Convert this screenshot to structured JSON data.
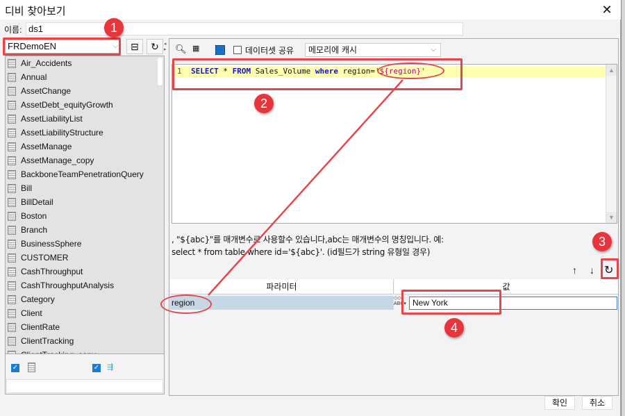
{
  "window": {
    "title": "디비 찾아보기",
    "close_icon": "close-icon"
  },
  "name_field": {
    "label": "이름:",
    "value": "ds1"
  },
  "database_select": {
    "value": "FRDemoEN"
  },
  "table_list": {
    "items": [
      "Air_Accidents",
      "Annual",
      "AssetChange",
      "AssetDebt_equityGrowth",
      "AssetLiabilityList",
      "AssetLiabilityStructure",
      "AssetManage",
      "AssetManage_copy",
      "BackboneTeamPenetrationQuery",
      "Bill",
      "BillDetail",
      "Boston",
      "Branch",
      "BusinessSphere",
      "CUSTOMER",
      "CashThroughput",
      "CashThroughputAnalysis",
      "Category",
      "Client",
      "ClientRate",
      "ClientTracking",
      "ClientTracking_copy"
    ],
    "show_tables_checked": true,
    "show_views_checked": true,
    "filter_value": ""
  },
  "query_toolbar": {
    "share_dataset_label": "데이터셋 공유",
    "share_dataset_checked": false,
    "cache_select_value": "메모리에 캐시"
  },
  "sql_editor": {
    "line_number": "1",
    "tokens": {
      "k1": "SELECT",
      "t1": " * ",
      "k2": "FROM",
      "t2": " Sales_Volume ",
      "k3": "where",
      "t3": " region=",
      "s1": "'${region}'"
    }
  },
  "hint": {
    "line1": ", \"${abc}\"를 매개변수로 사용할수 있습니다,abc는 매개변수의 명칭입니다. 예:",
    "line2": "select * from table where id='${abc}'. (id필드가 string 유형일 경우)"
  },
  "param_toolbar": {
    "up": "↑",
    "down": "↓",
    "refresh": "↻"
  },
  "parameters": {
    "headers": {
      "name": "파라미터",
      "value": "값"
    },
    "rows": [
      {
        "name": "region",
        "value": "New York"
      }
    ]
  },
  "footer": {
    "ok_label": "확인",
    "cancel_label": "취소"
  },
  "annotations": {
    "color": "#e8444a",
    "badges": [
      "1",
      "2",
      "3",
      "4"
    ]
  }
}
